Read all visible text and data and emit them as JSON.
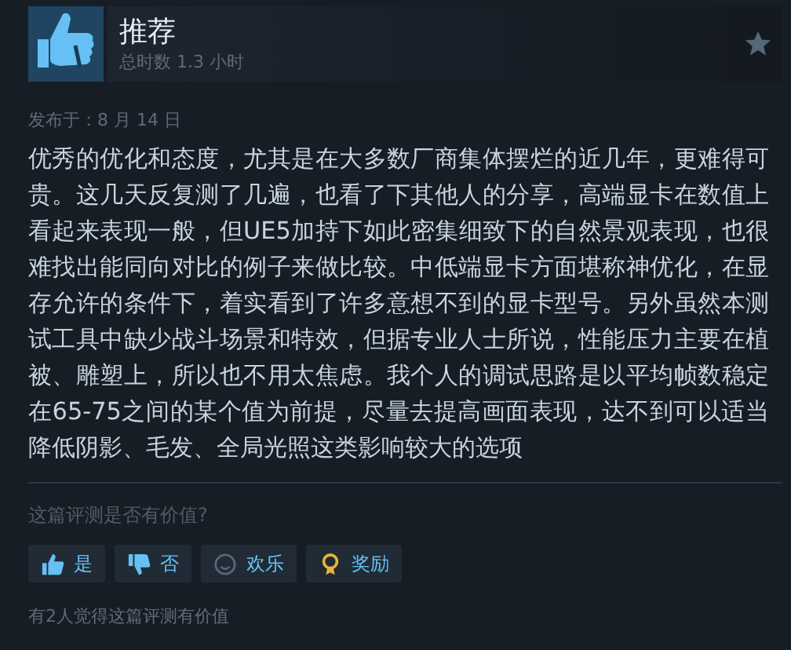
{
  "review": {
    "verdict": "推荐",
    "playtime": "总时数 1.3 小时",
    "posted": "发布于：8 月 14 日",
    "body": "优秀的优化和态度，尤其是在大多数厂商集体摆烂的近几年，更难得可贵。这几天反复测了几遍，也看了下其他人的分享，高端显卡在数值上看起来表现一般，但UE5加持下如此密集细致下的自然景观表现，也很难找出能同向对比的例子来做比较。中低端显卡方面堪称神优化，在显存允许的条件下，着实看到了许多意想不到的显卡型号。另外虽然本测试工具中缺少战斗场景和特效，但据专业人士所说，性能压力主要在植被、雕塑上，所以也不用太焦虑。我个人的调试思路是以平均帧数稳定在65-75之间的某个值为前提，尽量去提高画面表现，达不到可以适当降低阴影、毛发、全局光照这类影响较大的选项"
  },
  "helpful_prompt": "这篇评测是否有价值?",
  "buttons": [
    {
      "kind": "yes",
      "label": "是"
    },
    {
      "kind": "no",
      "label": "否"
    },
    {
      "kind": "funny",
      "label": "欢乐"
    },
    {
      "kind": "award",
      "label": "奖励"
    }
  ],
  "helpful_count": "有2人觉得这篇评测有价值"
}
